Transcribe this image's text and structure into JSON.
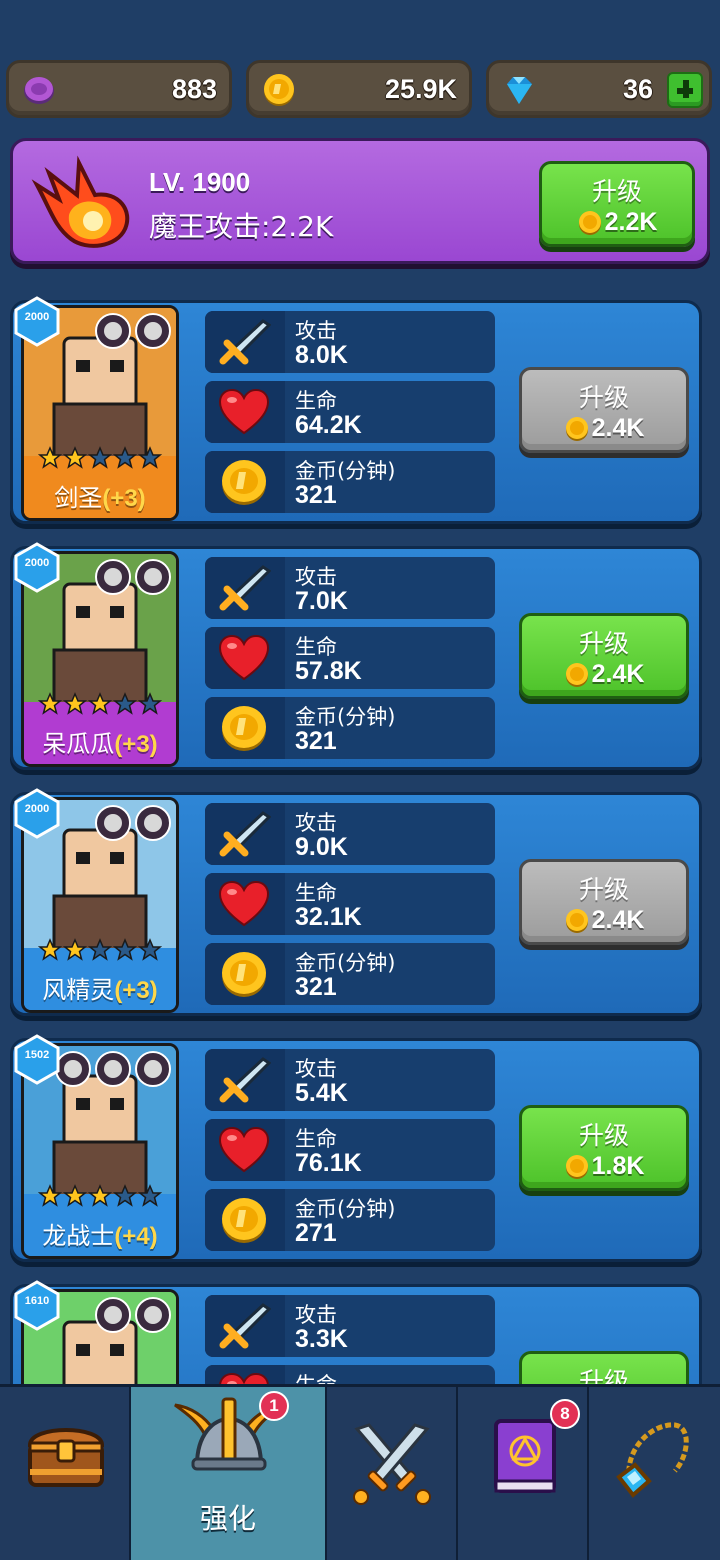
{
  "currencies": {
    "orb": {
      "value": "883",
      "icon": "purple-orb-icon"
    },
    "gold": {
      "value": "25.9K",
      "icon": "gold-coin-icon"
    },
    "gem": {
      "value": "36",
      "icon": "diamond-icon",
      "add_icon": "plus-icon"
    }
  },
  "boss": {
    "level": "LV. 1900",
    "attack": "魔王攻击:2.2K",
    "upgrade_label": "升级",
    "upgrade_cost": "2.2K",
    "icon": "fireball-icon"
  },
  "stat_labels": {
    "attack": "攻击",
    "hp": "生命",
    "gold": "金币(分钟)"
  },
  "heroes": [
    {
      "level": "2000",
      "name": "剑圣",
      "plus": "(+3)",
      "stars": 2,
      "max_stars": 5,
      "attack": "8.0K",
      "hp": "64.2K",
      "gold": "321",
      "upgrade_label": "升级",
      "upgrade_cost": "2.4K",
      "upgrade_available": false,
      "rarity_color": "#f08a1e",
      "badges": [
        "orc-class-icon",
        "sword-class-icon"
      ]
    },
    {
      "level": "2000",
      "name": "呆瓜瓜",
      "plus": "(+3)",
      "stars": 3,
      "max_stars": 5,
      "attack": "7.0K",
      "hp": "57.8K",
      "gold": "321",
      "upgrade_label": "升级",
      "upgrade_cost": "2.4K",
      "upgrade_available": true,
      "rarity_color": "#b13cd1",
      "badges": [
        "orc-class-icon",
        "dagger-class-icon"
      ]
    },
    {
      "level": "2000",
      "name": "风精灵",
      "plus": "(+3)",
      "stars": 2,
      "max_stars": 5,
      "attack": "9.0K",
      "hp": "32.1K",
      "gold": "321",
      "upgrade_label": "升级",
      "upgrade_cost": "2.4K",
      "upgrade_available": false,
      "rarity_color": "#2f8ee0",
      "badges": [
        "elf-class-icon",
        "wand-class-icon"
      ]
    },
    {
      "level": "1502",
      "name": "龙战士",
      "plus": "(+4)",
      "stars": 3,
      "max_stars": 5,
      "attack": "5.4K",
      "hp": "76.1K",
      "gold": "271",
      "upgrade_label": "升级",
      "upgrade_cost": "1.8K",
      "upgrade_available": true,
      "rarity_color": "#2f8ee0",
      "badges": [
        "knight-class-icon",
        "sword-class-icon",
        "dragon-class-icon"
      ]
    },
    {
      "level": "1610",
      "name": "",
      "plus": "",
      "stars": 0,
      "max_stars": 5,
      "attack": "3.3K",
      "hp": "",
      "gold": "",
      "upgrade_label": "升级",
      "upgrade_cost": "",
      "upgrade_available": true,
      "rarity_color": "#3cc24a",
      "badges": [
        "orc-class-icon",
        "sword-class-icon"
      ]
    }
  ],
  "nav": {
    "items": [
      {
        "icon": "treasure-chest-icon",
        "label": ""
      },
      {
        "icon": "winged-helmet-icon",
        "label": "强化",
        "badge": "1"
      },
      {
        "icon": "crossed-swords-icon",
        "label": ""
      },
      {
        "icon": "spellbook-icon",
        "label": "",
        "badge": "8"
      },
      {
        "icon": "amulet-icon",
        "label": ""
      }
    ]
  }
}
